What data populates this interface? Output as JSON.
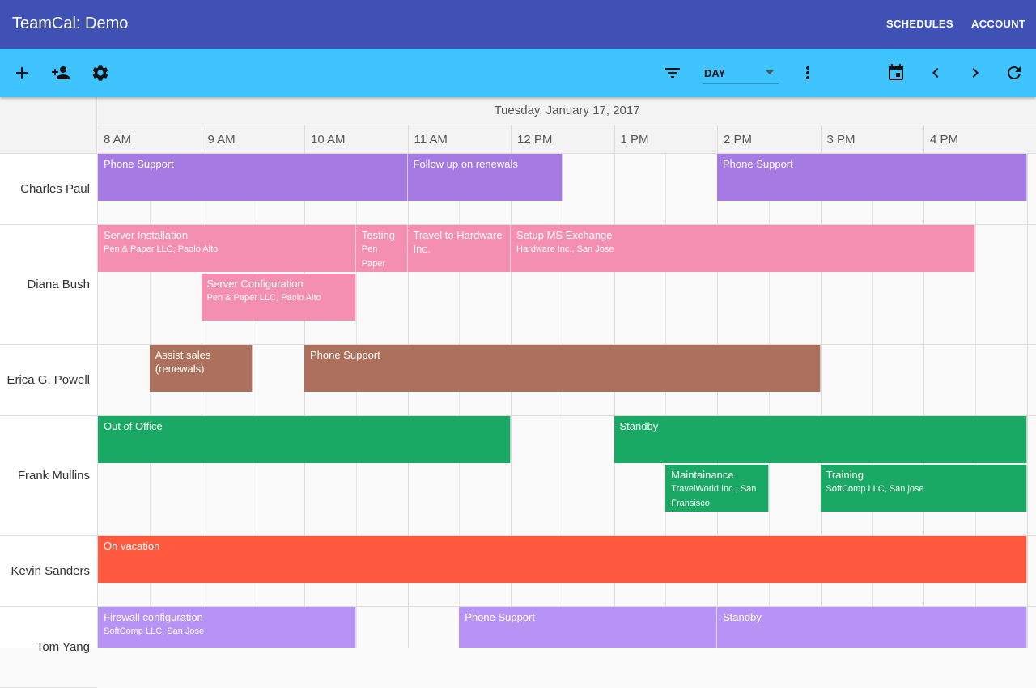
{
  "app": {
    "title": "TeamCal: Demo",
    "nav": [
      "SCHEDULES",
      "ACCOUNT"
    ]
  },
  "toolbar": {
    "left_icons": [
      "add-icon",
      "add-person-icon",
      "settings-icon"
    ],
    "view": "DAY",
    "right_icons": [
      "filter-icon",
      "more-vert-icon",
      "calendar-icon",
      "chevron-left-icon",
      "chevron-right-icon",
      "refresh-icon"
    ]
  },
  "schedule": {
    "date": "Tuesday, January 17, 2017",
    "hours": [
      "8 AM",
      "9 AM",
      "10 AM",
      "11 AM",
      "12 PM",
      "1 PM",
      "2 PM",
      "3 PM",
      "4 PM"
    ],
    "people": [
      {
        "name": "Charles Paul",
        "events": [
          {
            "title": "Phone Support",
            "sub": "",
            "start": "8:00",
            "end": "11:00",
            "lane": 0,
            "color": "#a57be3"
          },
          {
            "title": "Follow up on renewals",
            "sub": "",
            "start": "11:00",
            "end": "12:30",
            "lane": 0,
            "color": "#a57be3"
          },
          {
            "title": "Phone Support",
            "sub": "",
            "start": "14:00",
            "end": "17:00",
            "lane": 0,
            "color": "#a57be3"
          }
        ]
      },
      {
        "name": "Diana Bush",
        "events": [
          {
            "title": "Server Installation",
            "sub": "Pen & Paper LLC, Paolo Alto",
            "start": "8:00",
            "end": "10:30",
            "lane": 0,
            "color": "#f48fb1"
          },
          {
            "title": "Testing",
            "sub": "Pen Paper",
            "start": "10:30",
            "end": "11:00",
            "lane": 0,
            "color": "#f48fb1"
          },
          {
            "title": "Travel to Hardware Inc.",
            "sub": "",
            "start": "11:00",
            "end": "12:00",
            "lane": 0,
            "color": "#f48fb1"
          },
          {
            "title": "Setup MS Exchange",
            "sub": "Hardware Inc., San Jose",
            "start": "12:00",
            "end": "16:30",
            "lane": 0,
            "color": "#f48fb1"
          },
          {
            "title": "Server Configuration",
            "sub": "Pen & Paper LLC, Paolo Alto",
            "start": "9:00",
            "end": "10:30",
            "lane": 1,
            "color": "#f48fb1"
          }
        ]
      },
      {
        "name": "Erica G. Powell",
        "events": [
          {
            "title": "Assist sales (renewals)",
            "sub": "",
            "start": "8:30",
            "end": "9:30",
            "lane": 0,
            "color": "#ad705c"
          },
          {
            "title": "Phone Support",
            "sub": "",
            "start": "10:00",
            "end": "15:00",
            "lane": 0,
            "color": "#ad705c"
          }
        ]
      },
      {
        "name": "Frank Mullins",
        "events": [
          {
            "title": "Out of Office",
            "sub": "",
            "start": "8:00",
            "end": "12:00",
            "lane": 0,
            "color": "#1aa865"
          },
          {
            "title": "Standby",
            "sub": "",
            "start": "13:00",
            "end": "17:00",
            "lane": 0,
            "color": "#1aa865"
          },
          {
            "title": "Maintainance",
            "sub": "TravelWorld Inc., San Fransisco",
            "start": "13:30",
            "end": "14:30",
            "lane": 1,
            "color": "#1aa865"
          },
          {
            "title": "Training",
            "sub": "SoftComp LLC, San jose",
            "start": "15:00",
            "end": "17:00",
            "lane": 1,
            "color": "#1aa865"
          }
        ]
      },
      {
        "name": "Kevin Sanders",
        "events": [
          {
            "title": "On vacation",
            "sub": "",
            "start": "8:00",
            "end": "17:00",
            "lane": 0,
            "color": "#ff5a3f"
          }
        ]
      },
      {
        "name": "Tom Yang",
        "events": [
          {
            "title": "Firewall configuration",
            "sub": "SoftComp LLC, San Jose",
            "start": "8:00",
            "end": "10:30",
            "lane": 0,
            "color": "#b793f5"
          },
          {
            "title": "Phone Support",
            "sub": "",
            "start": "11:30",
            "end": "14:00",
            "lane": 0,
            "color": "#b793f5"
          },
          {
            "title": "Standby",
            "sub": "",
            "start": "14:00",
            "end": "17:00",
            "lane": 0,
            "color": "#b793f5"
          }
        ]
      }
    ]
  }
}
